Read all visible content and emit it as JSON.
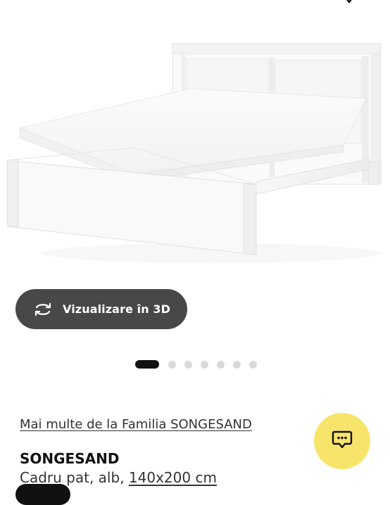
{
  "top": {
    "icon": "heart-icon"
  },
  "product_image": {
    "description_icon": "product-photo"
  },
  "view3d": {
    "label": "Vizualizare în 3D",
    "icon": "rotate-3d-icon"
  },
  "gallery": {
    "total_images": 7,
    "active_index": 0
  },
  "family": {
    "link_text": "Mai multe de la Familia SONGESAND"
  },
  "product": {
    "name": "SONGESAND",
    "description_prefix": "Cadru pat, alb, ",
    "size": "140x200 cm"
  },
  "chat": {
    "icon": "chat-icon",
    "color": "#f8e46a"
  },
  "colors": {
    "button_dark": "#484848",
    "dot_active": "#111111",
    "dot_inactive": "#d9d9d9"
  }
}
